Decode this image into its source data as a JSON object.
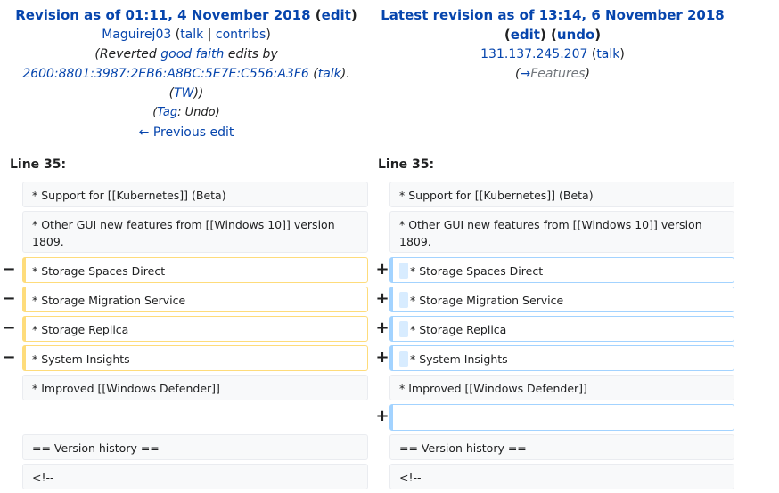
{
  "left_header": {
    "title_prefix": "Revision as of 01:11, 4 November 2018",
    "edit": "edit",
    "user": "Maguirej03",
    "talk": "talk",
    "contribs": "contribs",
    "summary_pre": "(Reverted ",
    "good_faith": "good faith",
    "summary_mid": " edits by",
    "ip": "2600:8801:3987:2EB6:A8BC:5E7E:C556:A3F6",
    "ip_talk": "talk",
    "tw": "TW",
    "tag_label": "Tag",
    "tag_value": "Undo",
    "prev_edit": "← Previous edit"
  },
  "right_header": {
    "title": "Latest revision as of 13:14, 6 November 2018",
    "edit": "edit",
    "undo": "undo",
    "ip": "131.137.245.207",
    "talk": "talk",
    "section_arrow": "→",
    "section": "Features"
  },
  "line_left": "Line 35:",
  "line_right": "Line 35:",
  "markers": {
    "minus": "−",
    "plus": "+"
  },
  "rows": {
    "r0": "* Support for [[Kubernetes]] (Beta)",
    "r1": "* Other GUI new features from [[Windows 10]] version 1809.",
    "r2": "* Storage Spaces Direct",
    "r3": "* Storage Migration Service",
    "r4": "* Storage Replica",
    "r5": "* System Insights",
    "r6": "* Improved [[Windows Defender]]",
    "r7": "",
    "r8": "== Version history ==",
    "r9": "<!--"
  }
}
